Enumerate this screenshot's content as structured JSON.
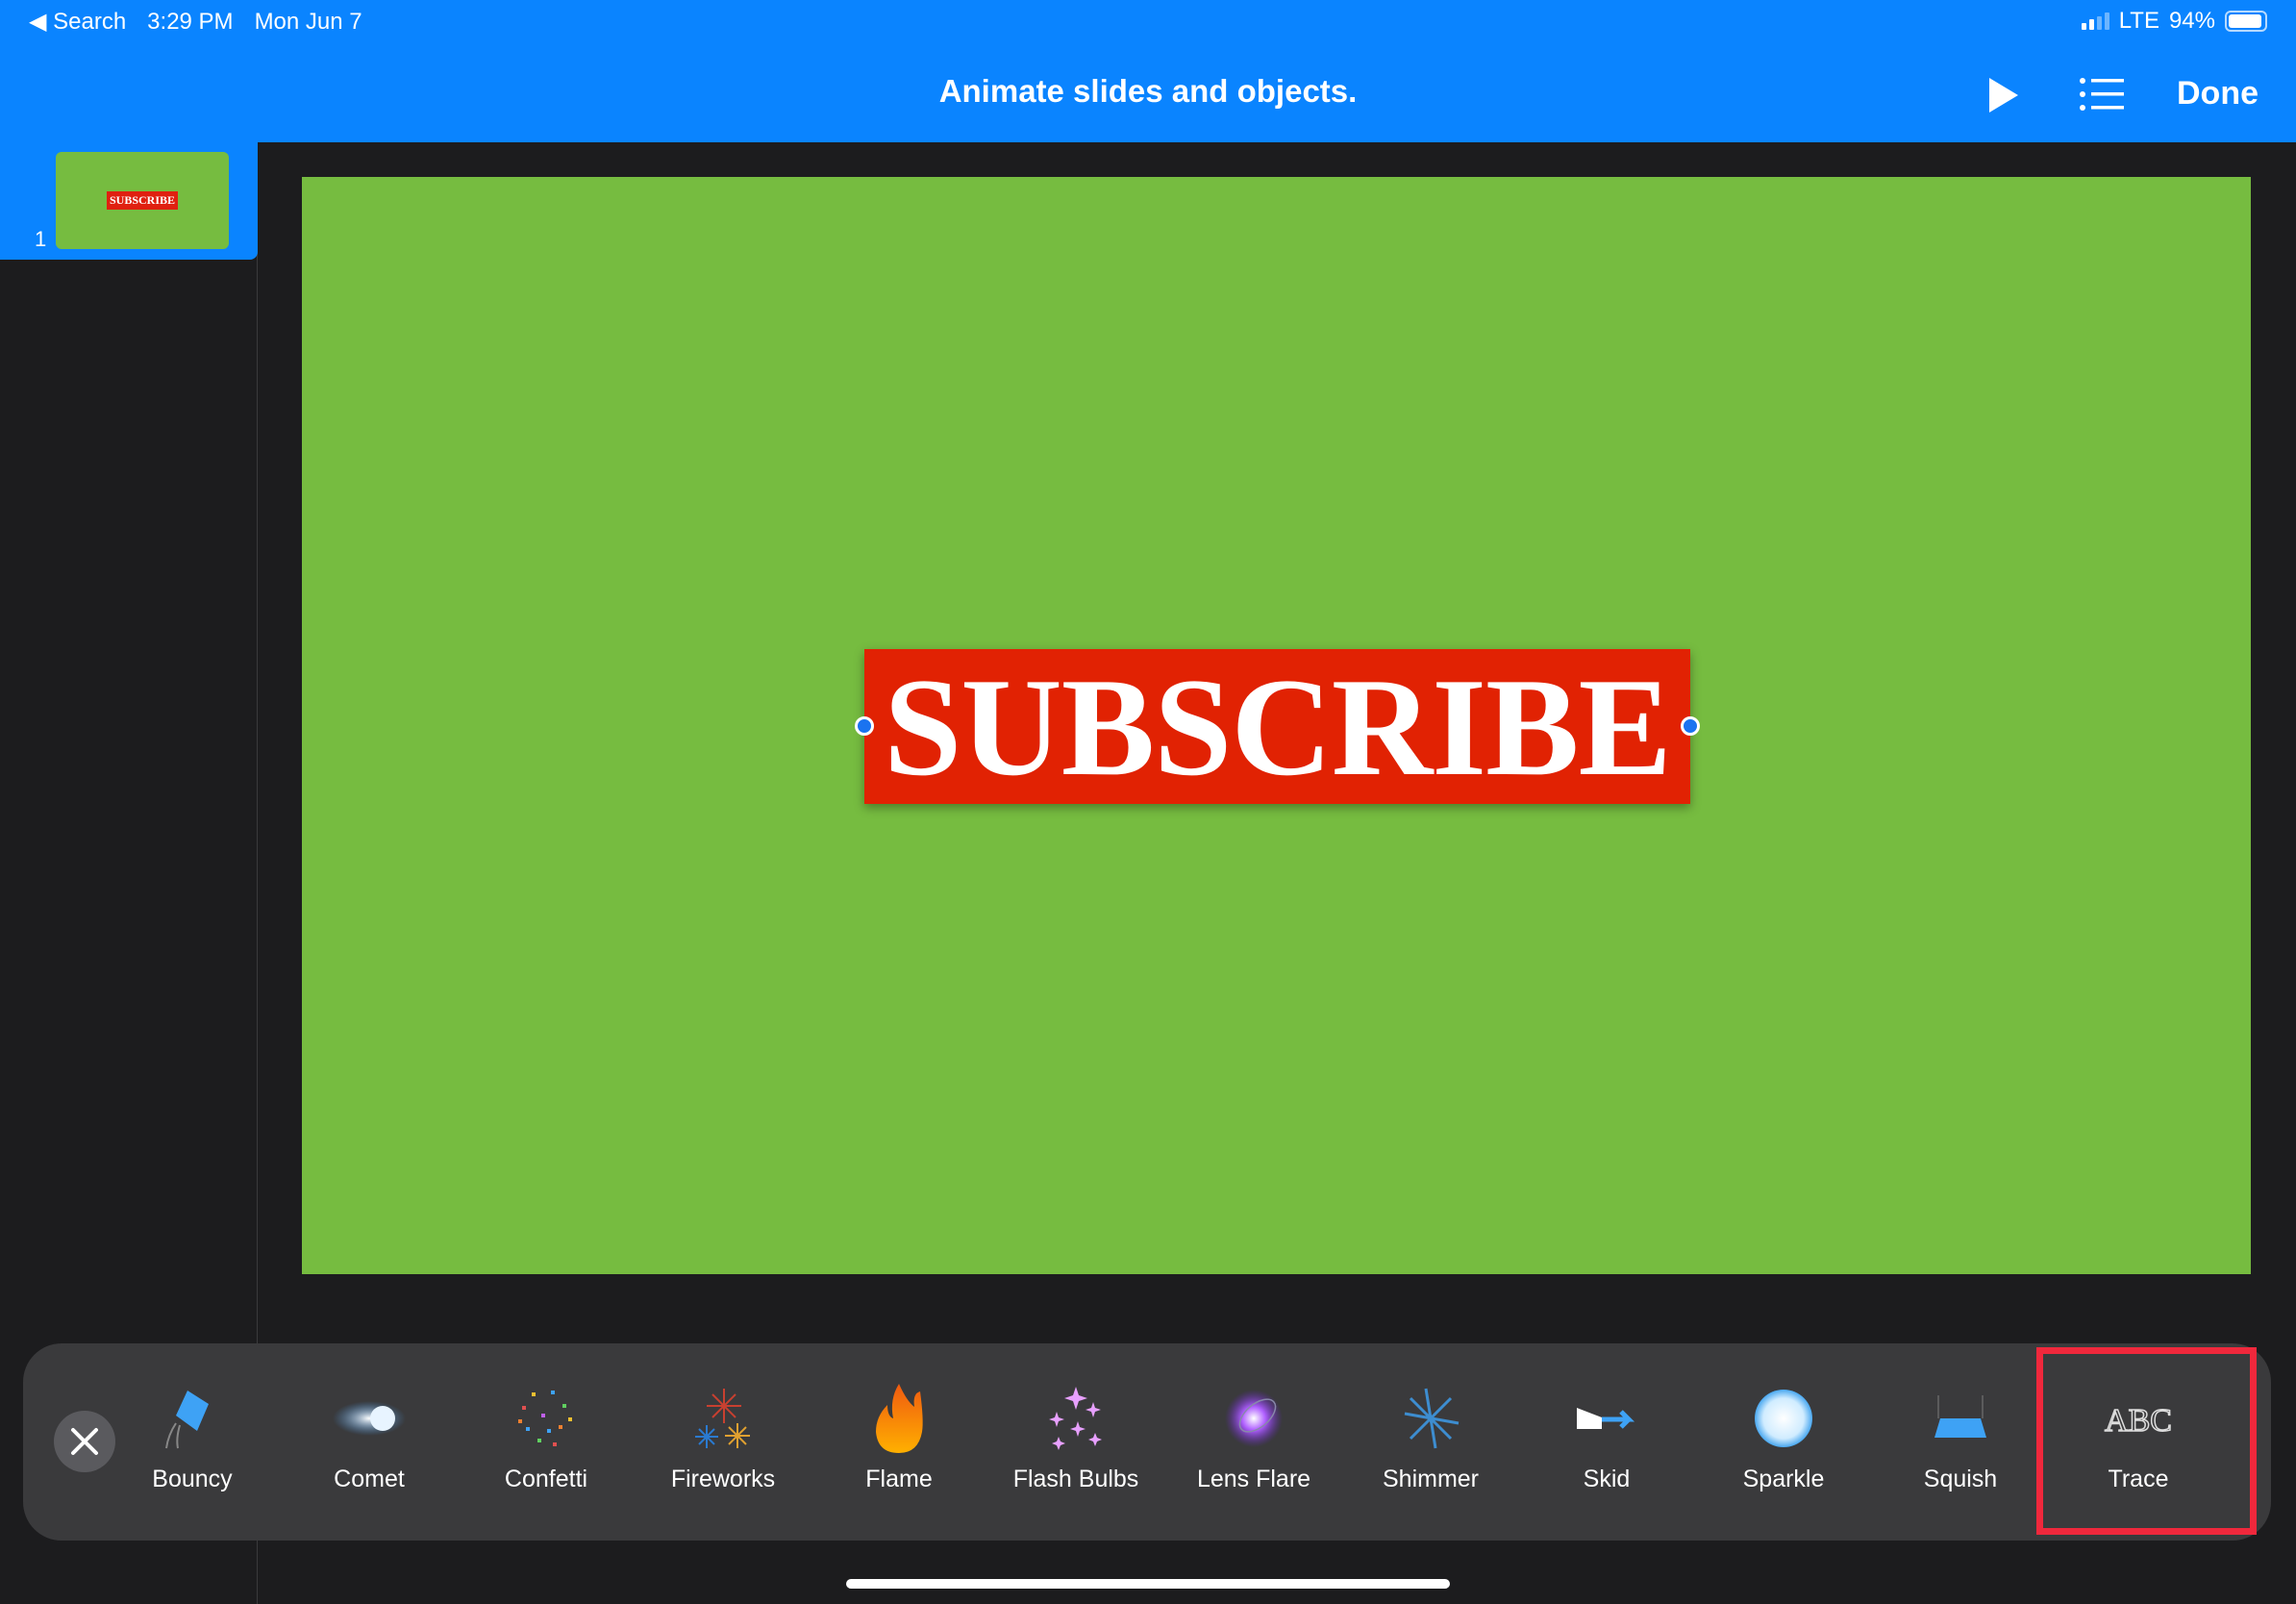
{
  "status_bar": {
    "back_label": "Search",
    "time": "3:29 PM",
    "date": "Mon Jun 7",
    "network": "LTE",
    "battery": "94%",
    "battery_level": 0.94
  },
  "nav": {
    "title": "Animate slides and objects.",
    "done_label": "Done"
  },
  "sidebar": {
    "slides": [
      {
        "number": "1",
        "thumb_text": "SUBSCRIBE"
      }
    ]
  },
  "slide": {
    "text": "SUBSCRIBE",
    "background": "#76bc40",
    "box_color": "#e12203"
  },
  "effects": [
    {
      "label": "Bouncy",
      "icon": "bouncy-icon"
    },
    {
      "label": "Comet",
      "icon": "comet-icon"
    },
    {
      "label": "Confetti",
      "icon": "confetti-icon"
    },
    {
      "label": "Fireworks",
      "icon": "fireworks-icon"
    },
    {
      "label": "Flame",
      "icon": "flame-icon"
    },
    {
      "label": "Flash Bulbs",
      "icon": "flash-bulbs-icon"
    },
    {
      "label": "Lens Flare",
      "icon": "lens-flare-icon"
    },
    {
      "label": "Shimmer",
      "icon": "shimmer-icon"
    },
    {
      "label": "Skid",
      "icon": "skid-icon"
    },
    {
      "label": "Sparkle",
      "icon": "sparkle-icon"
    },
    {
      "label": "Squish",
      "icon": "squish-icon"
    },
    {
      "label": "Trace",
      "icon": "trace-icon",
      "icon_text": "ABC",
      "highlighted": true
    }
  ]
}
